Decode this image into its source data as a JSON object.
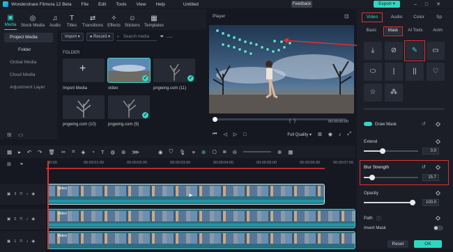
{
  "titlebar": {
    "app": "Wondershare Filmora 12 Beta",
    "menus": [
      "File",
      "Edit",
      "Tools",
      "View",
      "Help"
    ],
    "doc_title": "Untitled",
    "feedback": "Feedback",
    "export": "Export"
  },
  "media_tabs": [
    {
      "label": "Media",
      "icon": "media-icon"
    },
    {
      "label": "Stock Media",
      "icon": "stock-media-icon"
    },
    {
      "label": "Audio",
      "icon": "music-note-icon"
    },
    {
      "label": "Titles",
      "icon": "text-icon"
    },
    {
      "label": "Transitions",
      "icon": "transitions-icon"
    },
    {
      "label": "Effects",
      "icon": "effects-icon"
    },
    {
      "label": "Stickers",
      "icon": "stickers-icon"
    },
    {
      "label": "Templates",
      "icon": "templates-icon"
    }
  ],
  "media_side": {
    "project_media": "Project Media",
    "folder": "Folder",
    "global_media": "Global Media",
    "cloud_media": "Cloud Media",
    "adjustment_layer": "Adjustment Layer"
  },
  "media_tools": {
    "import": "Import",
    "record": "Record",
    "search_placeholder": "Search media"
  },
  "folder_label": "FOLDER",
  "media_items": [
    {
      "label": "Import Media"
    },
    {
      "label": "video",
      "selected": true
    },
    {
      "label": "pngwing.com (11)",
      "checked": true
    },
    {
      "label": "pngwing.com (10)"
    },
    {
      "label": "pngwing.com (9)",
      "checked": true
    }
  ],
  "player": {
    "title": "Player",
    "timecode_start": "00:00:00:00",
    "timecode_end": "00:00:00:00",
    "quality": "Full Quality",
    "progress": 0.0
  },
  "inspector": {
    "tabs": [
      "Video",
      "Audio",
      "Color",
      "Sp"
    ],
    "subtabs": [
      "Basic",
      "Mask",
      "AI Tools",
      "Anim"
    ],
    "draw_mask": "Draw Mask",
    "extend": {
      "label": "Extend",
      "value": "0.0",
      "fraction": 0.35
    },
    "blur_strength": {
      "label": "Blur Strength",
      "value": "15.7",
      "fraction": 0.16
    },
    "opacity": {
      "label": "Opacity",
      "value": "100.0",
      "fraction": 1.0
    },
    "path": "Path",
    "invert_mask": "Invert Mask",
    "reset": "Reset",
    "ok": "OK"
  },
  "timeline": {
    "ruler": [
      "00:00",
      "00:00:01:00",
      "00:00:02:00",
      "00:00:03:00",
      "00:00:04:00",
      "00:00:05:00",
      "00:00:06:00",
      "00:00:07:00"
    ],
    "tracks": [
      {
        "index": "3",
        "clip": "video"
      },
      {
        "index": "2",
        "clip": "video"
      },
      {
        "index": "1",
        "clip": "video"
      }
    ]
  },
  "colors": {
    "accent": "#3ad5c6",
    "highlight": "#e0312f",
    "panel": "#1b1e27"
  }
}
